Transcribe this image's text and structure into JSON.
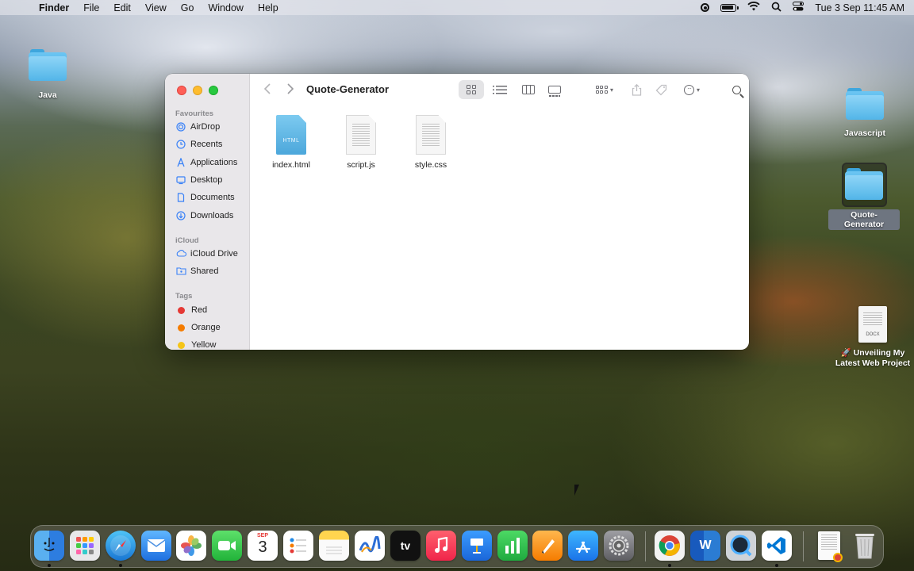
{
  "menubar": {
    "apple": "",
    "items": [
      "Finder",
      "File",
      "Edit",
      "View",
      "Go",
      "Window",
      "Help"
    ],
    "clock": "Tue 3 Sep  11:45 AM"
  },
  "desktop": {
    "icons": [
      {
        "label": "Java"
      },
      {
        "label": "Javascript"
      },
      {
        "label": "Quote-Generator"
      },
      {
        "label_line1": "🚀 Unveiling My",
        "label_line2": "Latest Web Project",
        "doc_tag": "DOCX"
      }
    ]
  },
  "finder": {
    "title": "Quote-Generator",
    "sidebar": {
      "favourites_heading": "Favourites",
      "favourites": [
        {
          "label": "AirDrop",
          "icon": "airdrop-icon"
        },
        {
          "label": "Recents",
          "icon": "clock-icon"
        },
        {
          "label": "Applications",
          "icon": "applications-icon"
        },
        {
          "label": "Desktop",
          "icon": "desktop-icon"
        },
        {
          "label": "Documents",
          "icon": "document-icon"
        },
        {
          "label": "Downloads",
          "icon": "download-icon"
        }
      ],
      "icloud_heading": "iCloud",
      "icloud": [
        {
          "label": "iCloud Drive",
          "icon": "cloud-icon"
        },
        {
          "label": "Shared",
          "icon": "shared-folder-icon"
        }
      ],
      "tags_heading": "Tags",
      "tags": [
        {
          "label": "Red",
          "color": "#e53935"
        },
        {
          "label": "Orange",
          "color": "#f57c00"
        },
        {
          "label": "Yellow",
          "color": "#f5c518"
        }
      ]
    },
    "files": [
      {
        "name": "index.html",
        "type": "html",
        "tag": "HTML"
      },
      {
        "name": "script.js",
        "type": "doc"
      },
      {
        "name": "style.css",
        "type": "doc"
      }
    ]
  },
  "dock": {
    "apps": [
      "Finder",
      "Launchpad",
      "Safari",
      "Mail",
      "Photos",
      "FaceTime",
      "Calendar",
      "Reminders",
      "Notes",
      "Freeform",
      "Apple TV",
      "Music",
      "Keynote",
      "Numbers",
      "Pages",
      "App Store",
      "System Settings",
      "Google Chrome",
      "Microsoft Word",
      "QuickTime Player",
      "Visual Studio Code",
      "Document Preview",
      "Trash"
    ],
    "calendar_month": "SEP",
    "calendar_day": "3",
    "tv_label": "tv",
    "word_letter": "W"
  }
}
